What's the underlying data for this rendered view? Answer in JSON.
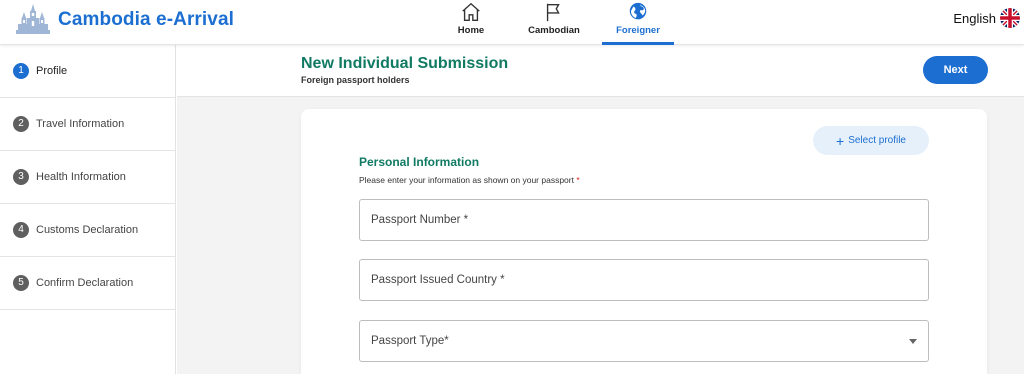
{
  "header": {
    "brand_name": "Cambodia e-Arrival",
    "nav": [
      {
        "label": "Home",
        "icon": "home-icon",
        "active": false
      },
      {
        "label": "Cambodian",
        "icon": "flag-icon",
        "active": false
      },
      {
        "label": "Foreigner",
        "icon": "globe-icon",
        "active": true
      }
    ],
    "language": "English",
    "language_flag": "uk-flag-icon"
  },
  "sidebar": {
    "steps": [
      {
        "number": "1",
        "label": "Profile",
        "active": true
      },
      {
        "number": "2",
        "label": "Travel Information",
        "active": false
      },
      {
        "number": "3",
        "label": "Health Information",
        "active": false
      },
      {
        "number": "4",
        "label": "Customs Declaration",
        "active": false
      },
      {
        "number": "5",
        "label": "Confirm Declaration",
        "active": false
      }
    ]
  },
  "subheader": {
    "title": "New Individual Submission",
    "caption": "Foreign passport holders",
    "next_label": "Next"
  },
  "form": {
    "select_profile_label": "Select profile",
    "section_title": "Personal Information",
    "section_desc": "Please enter your information as shown on your passport",
    "required_mark": "*",
    "fields": [
      {
        "label": "Passport Number *",
        "type": "text"
      },
      {
        "label": "Passport Issued Country *",
        "type": "text"
      },
      {
        "label": "Passport Type*",
        "type": "select"
      }
    ]
  },
  "colors": {
    "accent": "#1c6fd1",
    "green": "#107a63",
    "required": "#d42020"
  }
}
